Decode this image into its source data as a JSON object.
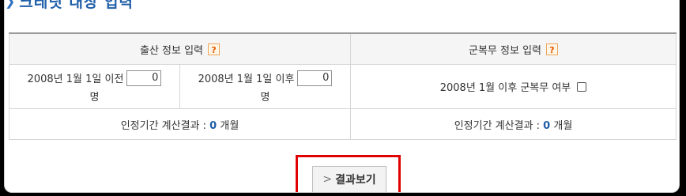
{
  "section_title": "크레딧 대상 입력",
  "birth": {
    "header": "출산 정보 입력",
    "help_glyph": "?",
    "before_label": "2008년 1월 1일 이전",
    "before_value": "0",
    "after_label": "2008년 1월 1일 이후",
    "after_value": "0",
    "unit": "명",
    "result_label": "인정기간 계산결과 :",
    "result_value": "0",
    "result_unit": "개월"
  },
  "military": {
    "header": "군복무 정보 입력",
    "help_glyph": "?",
    "question": "2008년 1월 이후 군복무 여부",
    "checked": false,
    "result_label": "인정기간 계산결과 :",
    "result_value": "0",
    "result_unit": "개월"
  },
  "result_button": {
    "label": "결과보기",
    "arrow": ">"
  },
  "colors": {
    "accent": "#1f5fa8",
    "highlight": "#e00000",
    "help": "#e35c00"
  }
}
